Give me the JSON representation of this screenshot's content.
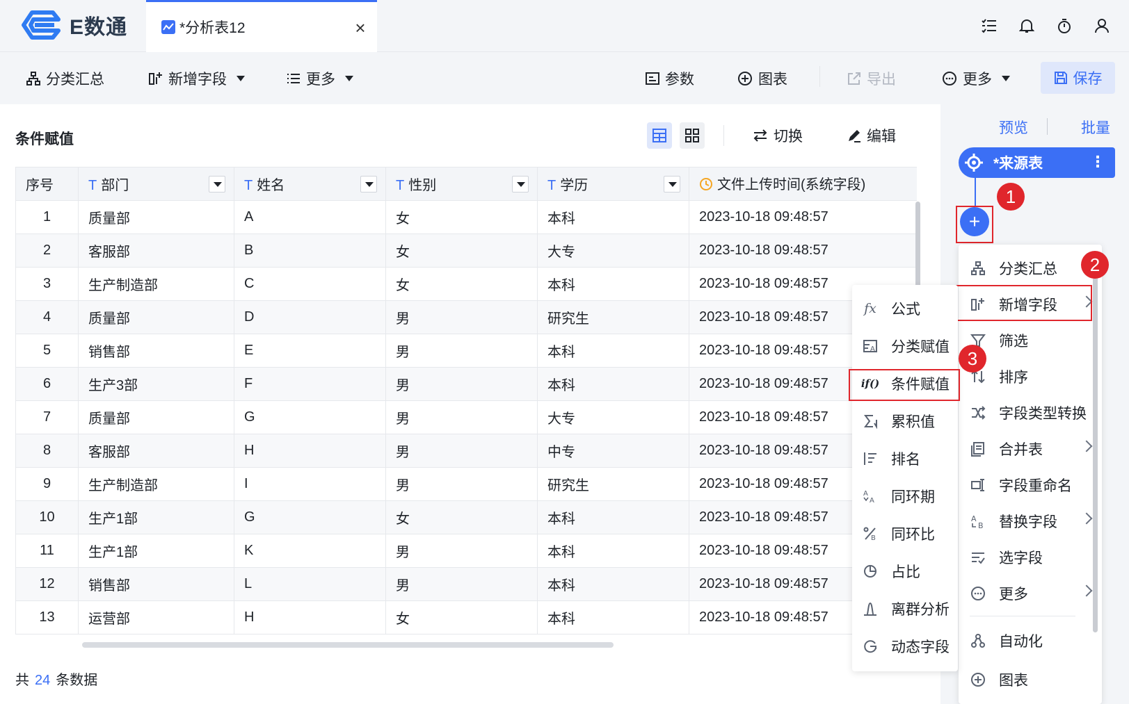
{
  "app": {
    "logo_text": "E数通"
  },
  "tab": {
    "label": "*分析表12",
    "close": "×"
  },
  "colors": {
    "accent": "#3b6ff5",
    "highlight": "#e0262c"
  },
  "toolbar": {
    "group_summary": "分类汇总",
    "add_field": "新增字段",
    "more_left": "更多",
    "params": "参数",
    "chart": "图表",
    "export": "导出",
    "more_right": "更多",
    "save": "保存"
  },
  "main": {
    "title": "条件赋值",
    "switch_label": "切换",
    "edit_label": "编辑"
  },
  "table": {
    "headers": [
      "序号",
      "部门",
      "姓名",
      "性别",
      "学历",
      "文件上传时间(系统字段)"
    ],
    "rows": [
      [
        "1",
        "质量部",
        "A",
        "女",
        "本科",
        "2023-10-18 09:48:57"
      ],
      [
        "2",
        "客服部",
        "B",
        "女",
        "大专",
        "2023-10-18 09:48:57"
      ],
      [
        "3",
        "生产制造部",
        "C",
        "女",
        "本科",
        "2023-10-18 09:48:57"
      ],
      [
        "4",
        "质量部",
        "D",
        "男",
        "研究生",
        "2023-10-18 09:48:57"
      ],
      [
        "5",
        "销售部",
        "E",
        "男",
        "本科",
        "2023-10-18 09:48:57"
      ],
      [
        "6",
        "生产3部",
        "F",
        "男",
        "本科",
        "2023-10-18 09:48:57"
      ],
      [
        "7",
        "质量部",
        "G",
        "男",
        "大专",
        "2023-10-18 09:48:57"
      ],
      [
        "8",
        "客服部",
        "H",
        "男",
        "中专",
        "2023-10-18 09:48:57"
      ],
      [
        "9",
        "生产制造部",
        "I",
        "男",
        "研究生",
        "2023-10-18 09:48:57"
      ],
      [
        "10",
        "生产1部",
        "G",
        "女",
        "本科",
        "2023-10-18 09:48:57"
      ],
      [
        "11",
        "生产1部",
        "K",
        "男",
        "本科",
        "2023-10-18 09:48:57"
      ],
      [
        "12",
        "销售部",
        "L",
        "男",
        "本科",
        "2023-10-18 09:48:57"
      ],
      [
        "13",
        "运营部",
        "H",
        "女",
        "本科",
        "2023-10-18 09:48:57"
      ]
    ]
  },
  "footer": {
    "prefix": "共",
    "count": "24",
    "suffix": "条数据"
  },
  "right_panel": {
    "preview": "预览",
    "batch": "批量",
    "source_node": "*来源表",
    "plus": "+",
    "badges": [
      "1",
      "2",
      "3"
    ]
  },
  "op_menu": {
    "items": [
      {
        "label": "分类汇总",
        "icon": "hierarchy-icon",
        "chevron": false
      },
      {
        "label": "新增字段",
        "icon": "add-field-icon",
        "chevron": true
      },
      {
        "label": "筛选",
        "icon": "filter-icon",
        "chevron": false
      },
      {
        "label": "排序",
        "icon": "sort-icon",
        "chevron": false
      },
      {
        "label": "字段类型转换",
        "icon": "shuffle-icon",
        "chevron": false
      },
      {
        "label": "合并表",
        "icon": "merge-table-icon",
        "chevron": true
      },
      {
        "label": "字段重命名",
        "icon": "rename-icon",
        "chevron": false
      },
      {
        "label": "替换字段",
        "icon": "replace-field-icon",
        "chevron": true
      },
      {
        "label": "选字段",
        "icon": "select-field-icon",
        "chevron": false
      },
      {
        "label": "更多",
        "icon": "more-circle-icon",
        "chevron": true
      },
      {
        "label": "自动化",
        "icon": "automation-icon",
        "chevron": false
      },
      {
        "label": "图表",
        "icon": "chart-icon",
        "chevron": false
      }
    ]
  },
  "sub_menu": {
    "items": [
      {
        "label": "公式",
        "icon": "formula-icon",
        "glyph": "fx"
      },
      {
        "label": "分类赋值",
        "icon": "category-assign-icon",
        "glyph": ""
      },
      {
        "label": "条件赋值",
        "icon": "condition-assign-icon",
        "glyph": "if()"
      },
      {
        "label": "累积值",
        "icon": "cumulative-icon",
        "glyph": ""
      },
      {
        "label": "排名",
        "icon": "rank-icon",
        "glyph": ""
      },
      {
        "label": "同环期",
        "icon": "period-compare-icon",
        "glyph": ""
      },
      {
        "label": "同环比",
        "icon": "ratio-compare-icon",
        "glyph": ""
      },
      {
        "label": "占比",
        "icon": "proportion-icon",
        "glyph": ""
      },
      {
        "label": "离群分析",
        "icon": "outlier-icon",
        "glyph": ""
      },
      {
        "label": "动态字段",
        "icon": "dynamic-field-icon",
        "glyph": ""
      }
    ]
  }
}
